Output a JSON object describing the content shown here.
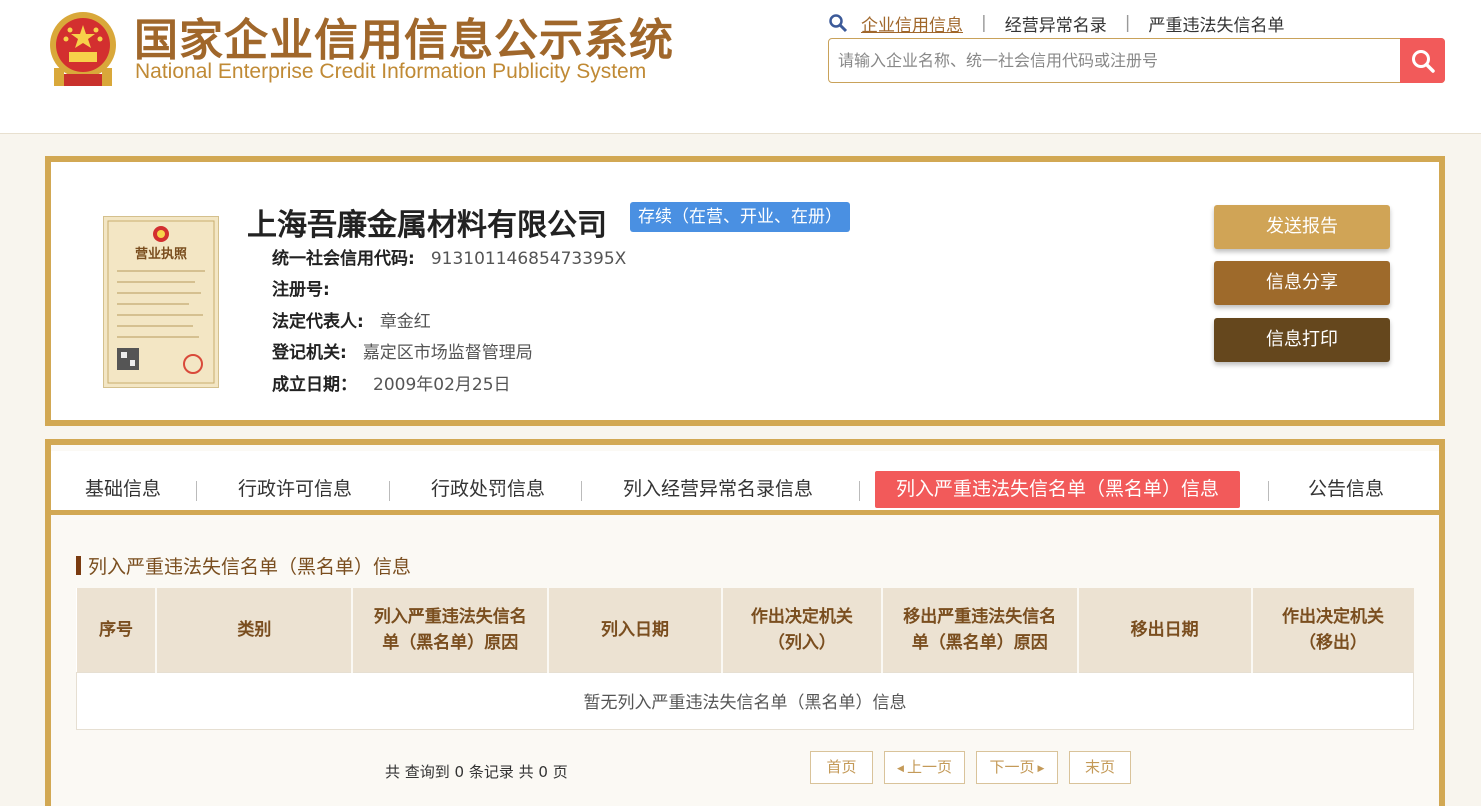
{
  "header": {
    "title_cn": "国家企业信用信息公示系统",
    "title_en": "National Enterprise Credit Information Publicity System",
    "links": [
      {
        "label": "企业信用信息"
      },
      {
        "label": "经营异常名录"
      },
      {
        "label": "严重违法失信名单"
      }
    ],
    "search_placeholder": "请输入企业名称、统一社会信用代码或注册号"
  },
  "company": {
    "name": "上海吾廉金属材料有限公司",
    "status": "存续（在营、开业、在册）",
    "license_title": "营业执照",
    "fields": [
      {
        "label": "统一社会信用代码:",
        "value": "91310114685473395X"
      },
      {
        "label": "注册号:",
        "value": ""
      },
      {
        "label": "法定代表人:",
        "value": "章金红"
      },
      {
        "label": "登记机关:",
        "value": "嘉定区市场监督管理局"
      },
      {
        "label": "成立日期：",
        "value": "2009年02月25日"
      }
    ],
    "actions": {
      "send": "发送报告",
      "share": "信息分享",
      "print": "信息打印"
    }
  },
  "tabs": [
    {
      "label": "基础信息"
    },
    {
      "label": "行政许可信息"
    },
    {
      "label": "行政处罚信息"
    },
    {
      "label": "列入经营异常名录信息"
    },
    {
      "label": "列入严重违法失信名单（黑名单）信息"
    },
    {
      "label": "公告信息"
    }
  ],
  "section": {
    "title": "列入严重违法失信名单（黑名单）信息",
    "columns": [
      {
        "l1": "序号",
        "l2": ""
      },
      {
        "l1": "类别",
        "l2": ""
      },
      {
        "l1": "列入严重违法失信名",
        "l2": "单（黑名单）原因"
      },
      {
        "l1": "列入日期",
        "l2": ""
      },
      {
        "l1": "作出决定机关",
        "l2": "（列入）"
      },
      {
        "l1": "移出严重违法失信名",
        "l2": "单（黑名单）原因"
      },
      {
        "l1": "移出日期",
        "l2": ""
      },
      {
        "l1": "作出决定机关",
        "l2": "（移出）"
      }
    ],
    "empty_text": "暂无列入严重违法失信名单（黑名单）信息"
  },
  "pager": {
    "summary": "共 查询到 0 条记录 共 0 页",
    "first": "首页",
    "prev": "上一页",
    "next": "下一页",
    "last": "末页"
  },
  "colors": {
    "gold_border": "#d2a853",
    "brand_brown": "#a0672b",
    "active_red": "#f25a5a",
    "status_blue": "#4a90e2"
  }
}
